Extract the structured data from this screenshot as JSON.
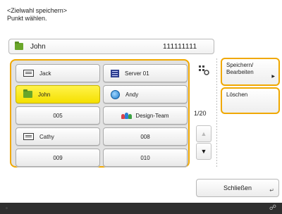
{
  "header": {
    "line1": "<Zielwahl speichern>",
    "line2": "Punkt wählen."
  },
  "selected_entry": {
    "name": "John",
    "number": "111111111",
    "icon": "folder-icon"
  },
  "grid": {
    "rows": [
      {
        "left": {
          "label": "Jack",
          "icon": "address-card-icon"
        },
        "right": {
          "label": "Server 01",
          "icon": "server-icon"
        }
      },
      {
        "left": {
          "label": "John",
          "icon": "folder-icon",
          "selected": true
        },
        "right": {
          "label": "Andy",
          "icon": "globe-icon"
        }
      },
      {
        "left": {
          "label": "005"
        },
        "right": {
          "label": "Design-Team",
          "icon": "group-icon"
        }
      },
      {
        "left": {
          "label": "Cathy",
          "icon": "address-card-icon"
        },
        "right": {
          "label": "008"
        }
      },
      {
        "left": {
          "label": "009"
        },
        "right": {
          "label": "010"
        }
      }
    ]
  },
  "pager": {
    "page": "1/20"
  },
  "actions": {
    "store_edit": "Speichern/ Bearbeiten",
    "delete": "Löschen",
    "close": "Schließen"
  },
  "colors": {
    "accent": "#f0a800",
    "selected": "#f5e000",
    "status_bar": "#2f2f2f"
  }
}
